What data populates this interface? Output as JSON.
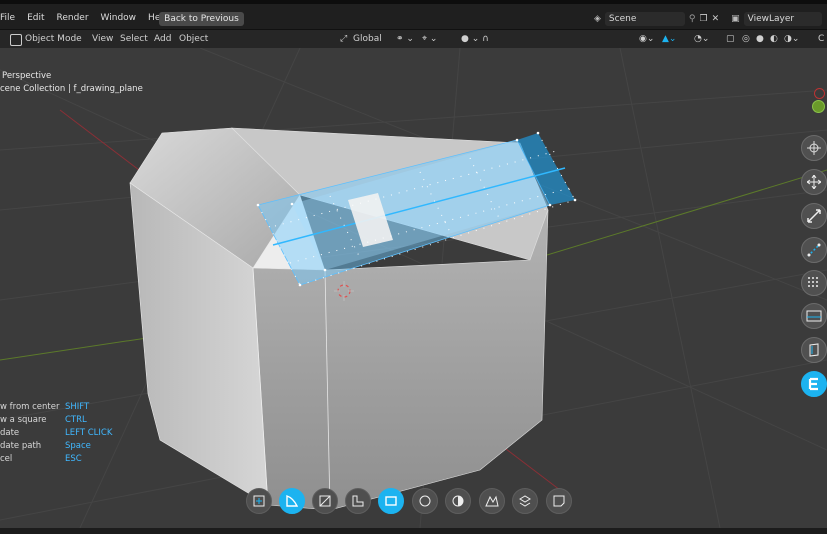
{
  "menu": {
    "file": "File",
    "edit": "Edit",
    "render": "Render",
    "window": "Window",
    "help": "Help",
    "back": "Back to Previous",
    "scene": "Scene",
    "view_layer": "ViewLayer"
  },
  "header": {
    "mode": "Object Mode",
    "view": "View",
    "select": "Select",
    "add": "Add",
    "object": "Object",
    "orientation": "Global"
  },
  "viewport": {
    "perspective": "Perspective",
    "collection": "cene Collection | f_drawing_plane"
  },
  "shortcuts": [
    {
      "label": "w from center",
      "key": "SHIFT"
    },
    {
      "label": "w a square",
      "key": "CTRL"
    },
    {
      "label": "date",
      "key": "LEFT CLICK"
    },
    {
      "label": "date path",
      "key": "Space"
    },
    {
      "label": "cel",
      "key": "ESC"
    }
  ],
  "colors": {
    "accent": "#1cb3f0",
    "key_text": "#40b8ff",
    "viewport_bg": "#3b3b3b"
  },
  "icons": {
    "gizmo": [
      "cursor-icon",
      "move-icon",
      "scale-icon",
      "measure-icon",
      "grid-icon",
      "plane-view-icon",
      "face-icon",
      "logo-e-icon"
    ],
    "bottom": [
      "add-box-icon",
      "draw-corner-icon",
      "slice-icon",
      "step-icon",
      "rectangle-icon",
      "circle-icon",
      "circle-half-icon",
      "polygon-icon",
      "extract-icon",
      "note-icon"
    ]
  }
}
